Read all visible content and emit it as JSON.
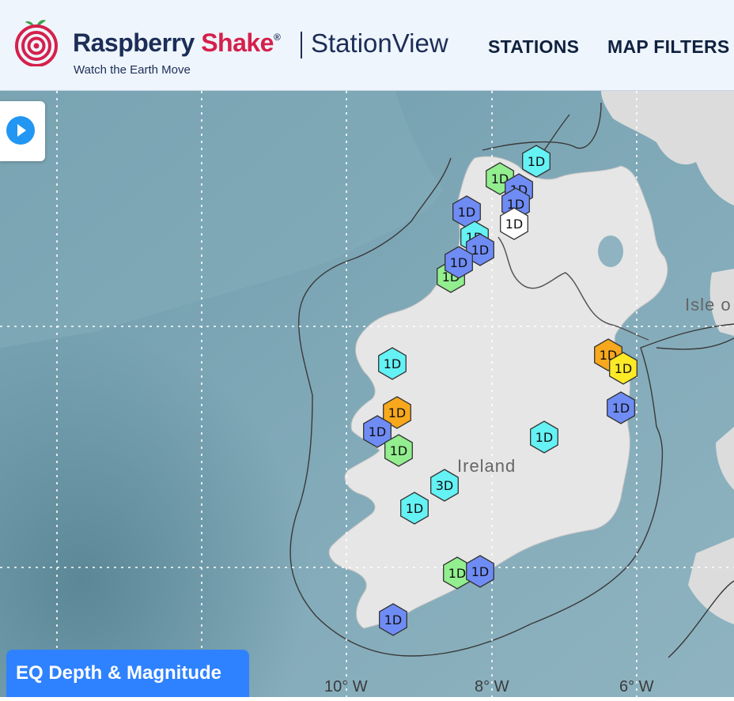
{
  "header": {
    "brand_part1": "Raspberry",
    "brand_part2": "Shake",
    "brand_mark": "®",
    "product_name": "StationView",
    "tagline": "Watch the Earth Move",
    "nav": {
      "stations": "STATIONS",
      "map_filters": "MAP FILTERS"
    }
  },
  "map": {
    "country_label": "Ireland",
    "isle_label": "Isle o",
    "longitude_labels": [
      "10° W",
      "8° W",
      "6° W"
    ],
    "legend_button": "EQ Depth & Magnitude",
    "stations": [
      {
        "label": "1D",
        "color": "#64f2f4"
      },
      {
        "label": "1D",
        "color": "#92ee8e"
      },
      {
        "label": "1D",
        "color": "#6f8cf5"
      },
      {
        "label": "1D",
        "color": "#6f8cf5"
      },
      {
        "label": "1D",
        "color": "#6f8cf5"
      },
      {
        "label": "1D",
        "color": "#ffffff"
      },
      {
        "label": "1D",
        "color": "#64f2f4"
      },
      {
        "label": "1D",
        "color": "#6f8cf5"
      },
      {
        "label": "1D",
        "color": "#92ee8e"
      },
      {
        "label": "1D",
        "color": "#6f8cf5"
      },
      {
        "label": "1D",
        "color": "#64f2f4"
      },
      {
        "label": "1D",
        "color": "#f7a81c"
      },
      {
        "label": "1D",
        "color": "#6f8cf5"
      },
      {
        "label": "1D",
        "color": "#92ee8e"
      },
      {
        "label": "3D",
        "color": "#64f2f4"
      },
      {
        "label": "1D",
        "color": "#64f2f4"
      },
      {
        "label": "1D",
        "color": "#64f2f4"
      },
      {
        "label": "1D",
        "color": "#f7a81c"
      },
      {
        "label": "1D",
        "color": "#fdea26"
      },
      {
        "label": "1D",
        "color": "#6f8cf5"
      },
      {
        "label": "1D",
        "color": "#92ee8e"
      },
      {
        "label": "1D",
        "color": "#6f8cf5"
      },
      {
        "label": "1D",
        "color": "#6f8cf5"
      }
    ]
  },
  "colors": {
    "brand_navy": "#1c2d57",
    "brand_red": "#d5204c",
    "legend_blue": "#2f82ff",
    "toggle_blue": "#2196f3"
  }
}
